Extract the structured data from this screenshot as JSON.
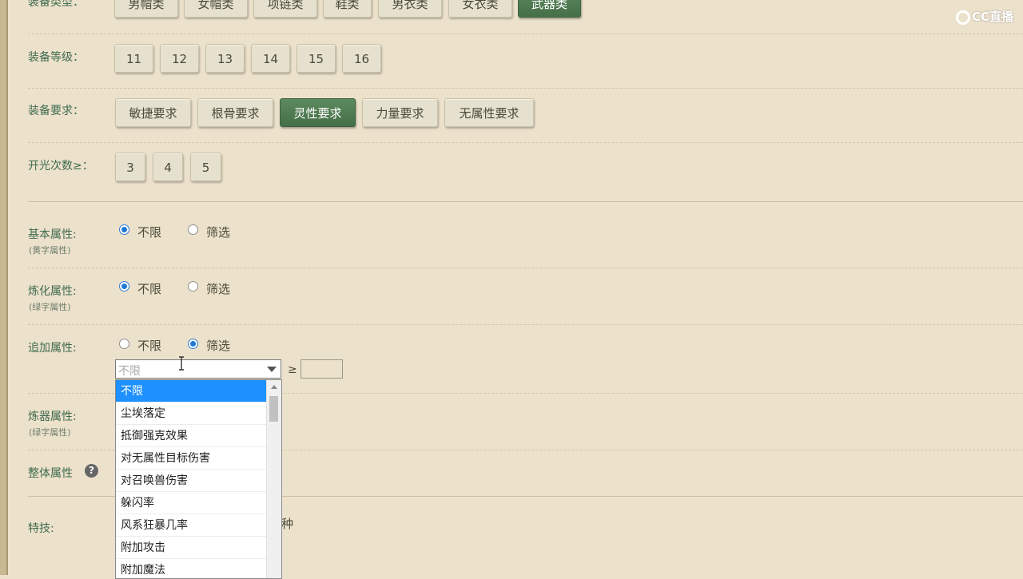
{
  "watermark": "CC直播",
  "type_row": {
    "label": "装备类型：",
    "buttons": [
      "男帽类",
      "女帽类",
      "项链类",
      "鞋类",
      "男衣类",
      "女衣类",
      "武器类"
    ]
  },
  "level_row": {
    "label": "装备等级：",
    "buttons": [
      "11",
      "12",
      "13",
      "14",
      "15",
      "16"
    ]
  },
  "req_row": {
    "label": "装备要求：",
    "buttons": [
      "敏捷要求",
      "根骨要求",
      "灵性要求",
      "力量要求",
      "无属性要求"
    ]
  },
  "glow_row": {
    "label": "开光次数≥：",
    "buttons": [
      "3",
      "4",
      "5"
    ]
  },
  "basic_attr": {
    "label": "基本属性:",
    "sub": "(黄字属性)",
    "opt1": "不限",
    "opt2": "筛选"
  },
  "refine_attr": {
    "label": "炼化属性:",
    "sub": "(绿字属性)",
    "opt1": "不限",
    "opt2": "筛选"
  },
  "extra_attr": {
    "label": "追加属性:",
    "opt1": "不限",
    "opt2": "筛选",
    "select_placeholder": "不限",
    "gte": "≥",
    "options": [
      "不限",
      "尘埃落定",
      "抵御强克效果",
      "对无属性目标伤害",
      "对召唤兽伤害",
      "躲闪率",
      "风系狂暴几率",
      "附加攻击",
      "附加魔法"
    ]
  },
  "forge_attr": {
    "label": "炼器属性:",
    "sub": "(绿字属性)"
  },
  "overall_attr": {
    "label": "整体属性",
    "help": "?"
  },
  "skill": {
    "label": "特技:",
    "trailing": "种"
  }
}
